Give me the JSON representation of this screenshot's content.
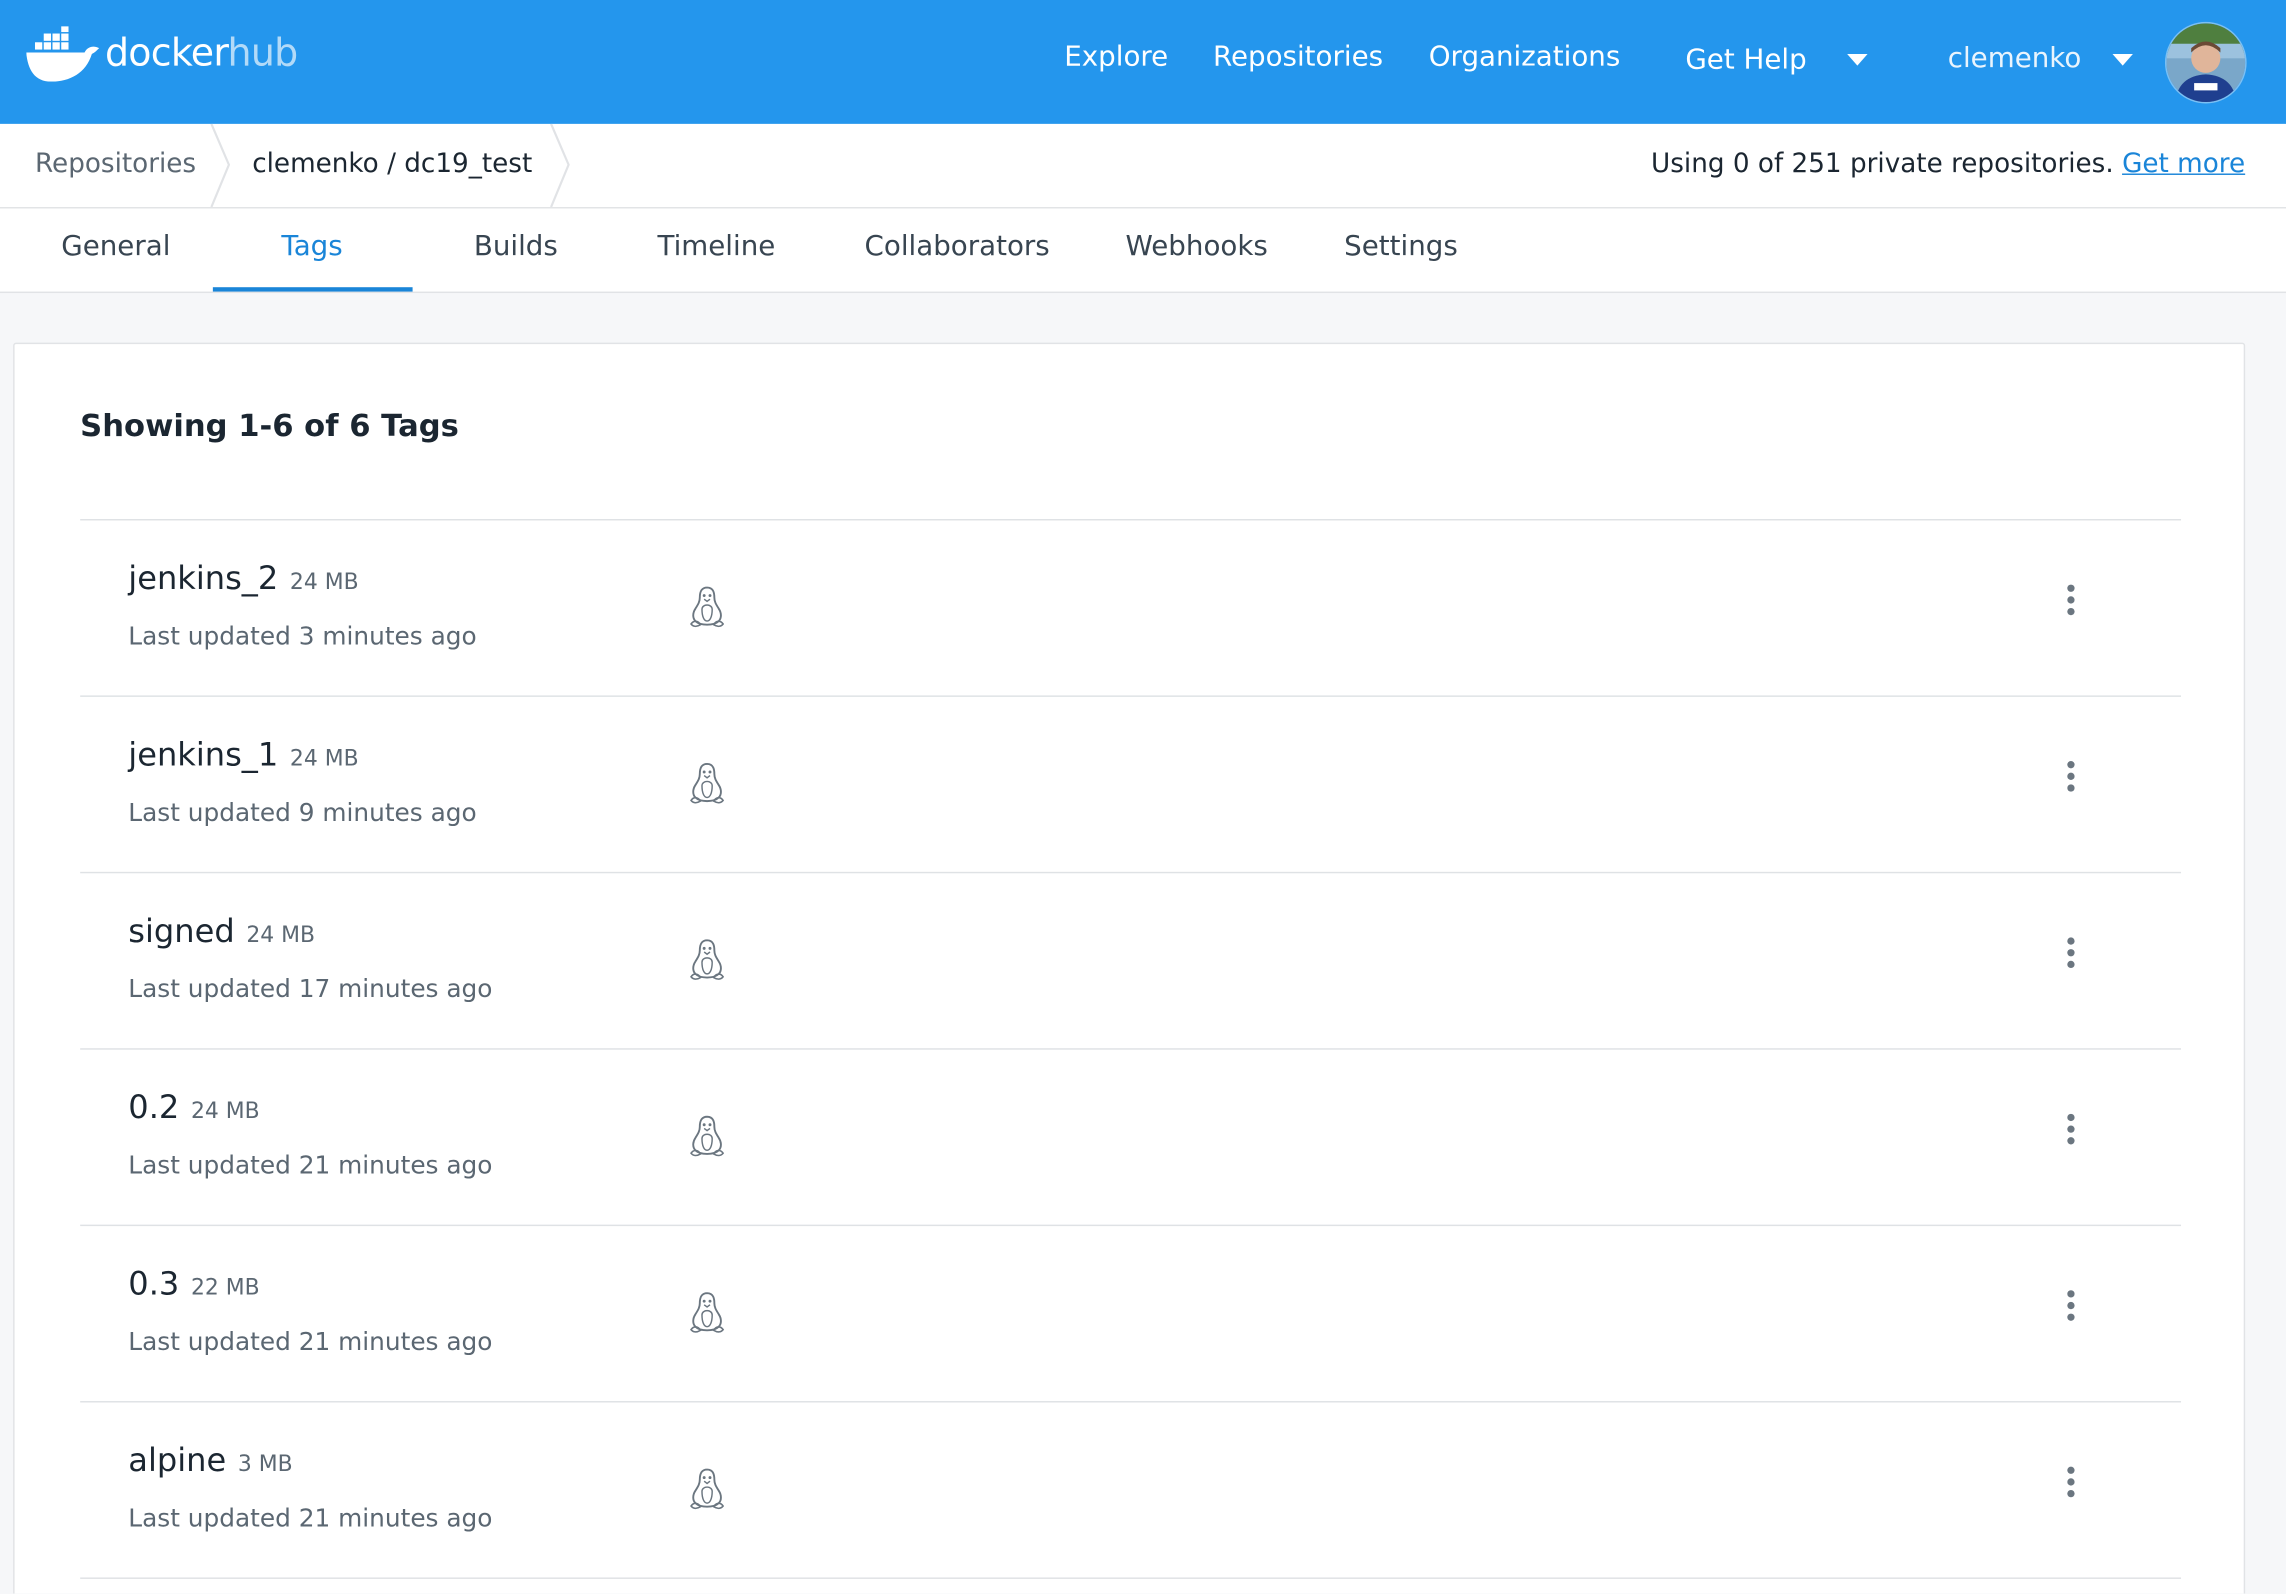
{
  "colors": {
    "brand": "#2496ed",
    "link": "#1a85d8",
    "text": "#1b2631",
    "muted": "#5b6772"
  },
  "nav": {
    "logo_docker": "docker",
    "logo_hub": "hub",
    "explore": "Explore",
    "repositories": "Repositories",
    "organizations": "Organizations",
    "get_help": "Get Help",
    "username": "clemenko",
    "avatar_icon": "user-avatar"
  },
  "breadcrumb": {
    "root": "Repositories",
    "current": "clemenko / dc19_test",
    "usage_text": "Using 0 of 251 private repositories.",
    "get_more": "Get more"
  },
  "tabs": [
    {
      "label": "General"
    },
    {
      "label": "Tags",
      "active": true
    },
    {
      "label": "Builds"
    },
    {
      "label": "Timeline"
    },
    {
      "label": "Collaborators"
    },
    {
      "label": "Webhooks"
    },
    {
      "label": "Settings"
    }
  ],
  "tags_panel": {
    "heading": "Showing 1-6 of 6 Tags",
    "os_icon": "linux-icon",
    "menu_icon": "more-vertical-icon",
    "rows": [
      {
        "name": "jenkins_2",
        "size": "24 MB",
        "updated": "Last updated 3 minutes ago"
      },
      {
        "name": "jenkins_1",
        "size": "24 MB",
        "updated": "Last updated 9 minutes ago"
      },
      {
        "name": "signed",
        "size": "24 MB",
        "updated": "Last updated 17 minutes ago"
      },
      {
        "name": "0.2",
        "size": "24 MB",
        "updated": "Last updated 21 minutes ago"
      },
      {
        "name": "0.3",
        "size": "22 MB",
        "updated": "Last updated 21 minutes ago"
      },
      {
        "name": "alpine",
        "size": "3 MB",
        "updated": "Last updated 21 minutes ago"
      }
    ]
  }
}
